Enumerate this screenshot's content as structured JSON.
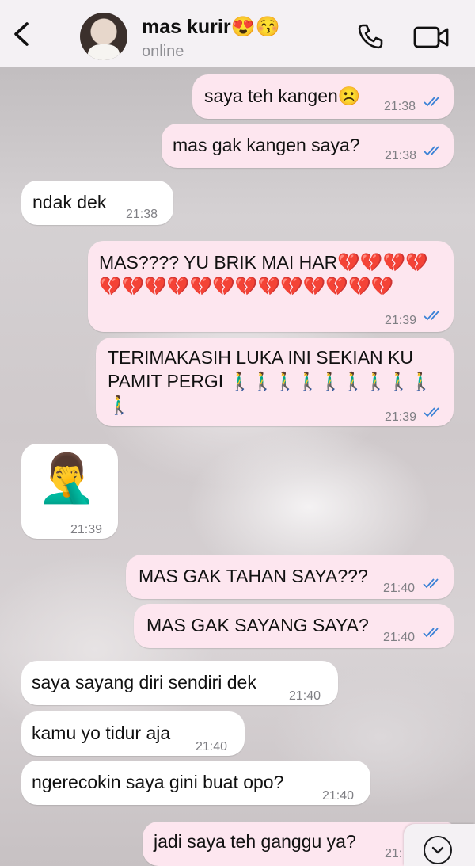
{
  "header": {
    "contact_name": "mas kurir😍😚",
    "status": "online"
  },
  "messages": [
    {
      "dir": "out",
      "text": "saya teh kangen☹️",
      "time": "21:38",
      "read": true
    },
    {
      "dir": "out",
      "text": "mas gak kangen saya?",
      "time": "21:38",
      "read": true
    },
    {
      "dir": "in",
      "text": "ndak dek",
      "time": "21:38"
    },
    {
      "dir": "out",
      "text": "MAS???? YU BRIK MAI HAR💔💔💔💔💔💔💔💔💔💔💔💔💔💔💔💔💔",
      "time": "21:39",
      "read": true
    },
    {
      "dir": "out",
      "text": "TERIMAKASIH LUKA INI SEKIAN KU PAMIT PERGI 🚶‍♂️🚶‍♂️🚶‍♂️🚶‍♂️🚶‍♂️🚶‍♂️🚶‍♂️🚶‍♂️🚶‍♂️🚶‍♂️",
      "time": "21:39",
      "read": true
    },
    {
      "dir": "in",
      "text": "🤦‍♂️",
      "time": "21:39"
    },
    {
      "dir": "out",
      "text": "MAS GAK TAHAN SAYA???",
      "time": "21:40",
      "read": true
    },
    {
      "dir": "out",
      "text": "MAS GAK SAYANG SAYA?",
      "time": "21:40",
      "read": true
    },
    {
      "dir": "in",
      "text": "saya sayang diri sendiri dek",
      "time": "21:40"
    },
    {
      "dir": "in",
      "text": "kamu yo tidur aja",
      "time": "21:40"
    },
    {
      "dir": "in",
      "text": "ngerecokin saya gini buat opo?",
      "time": "21:40"
    },
    {
      "dir": "out",
      "text": "jadi saya teh ganggu ya?",
      "time": "21:"
    }
  ],
  "colors": {
    "outgoing_bubble": "#fde6ef",
    "incoming_bubble": "#ffffff",
    "read_tick": "#3b82d6",
    "header_bg": "#f4f1f4"
  },
  "icons": [
    "back-chevron-icon",
    "phone-icon",
    "video-camera-icon",
    "chevron-down-icon",
    "double-check-icon"
  ]
}
